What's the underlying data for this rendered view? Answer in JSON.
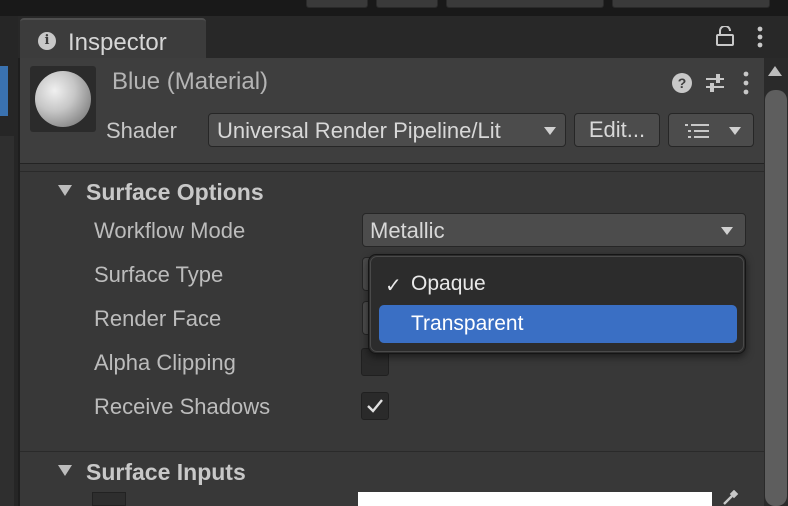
{
  "tab": {
    "label": "Inspector"
  },
  "material": {
    "title": "Blue (Material)",
    "shader_label": "Shader",
    "shader_value": "Universal Render Pipeline/Lit",
    "edit_label": "Edit..."
  },
  "surface_options": {
    "title": "Surface Options",
    "workflow_label": "Workflow Mode",
    "workflow_value": "Metallic",
    "surface_type_label": "Surface Type",
    "render_face_label": "Render Face",
    "alpha_clipping_label": "Alpha Clipping",
    "alpha_clipping_checked": false,
    "receive_shadows_label": "Receive Shadows",
    "receive_shadows_checked": true
  },
  "surface_type_popup": {
    "options": [
      {
        "label": "Opaque",
        "checked": true,
        "highlighted": false
      },
      {
        "label": "Transparent",
        "checked": false,
        "highlighted": true
      }
    ],
    "check_glyph": "✓"
  },
  "surface_inputs": {
    "title": "Surface Inputs"
  },
  "colors": {
    "highlight": "#3a6fc4",
    "panel": "#383838",
    "header": "#3e3e3e",
    "field": "#4c4c4c"
  }
}
